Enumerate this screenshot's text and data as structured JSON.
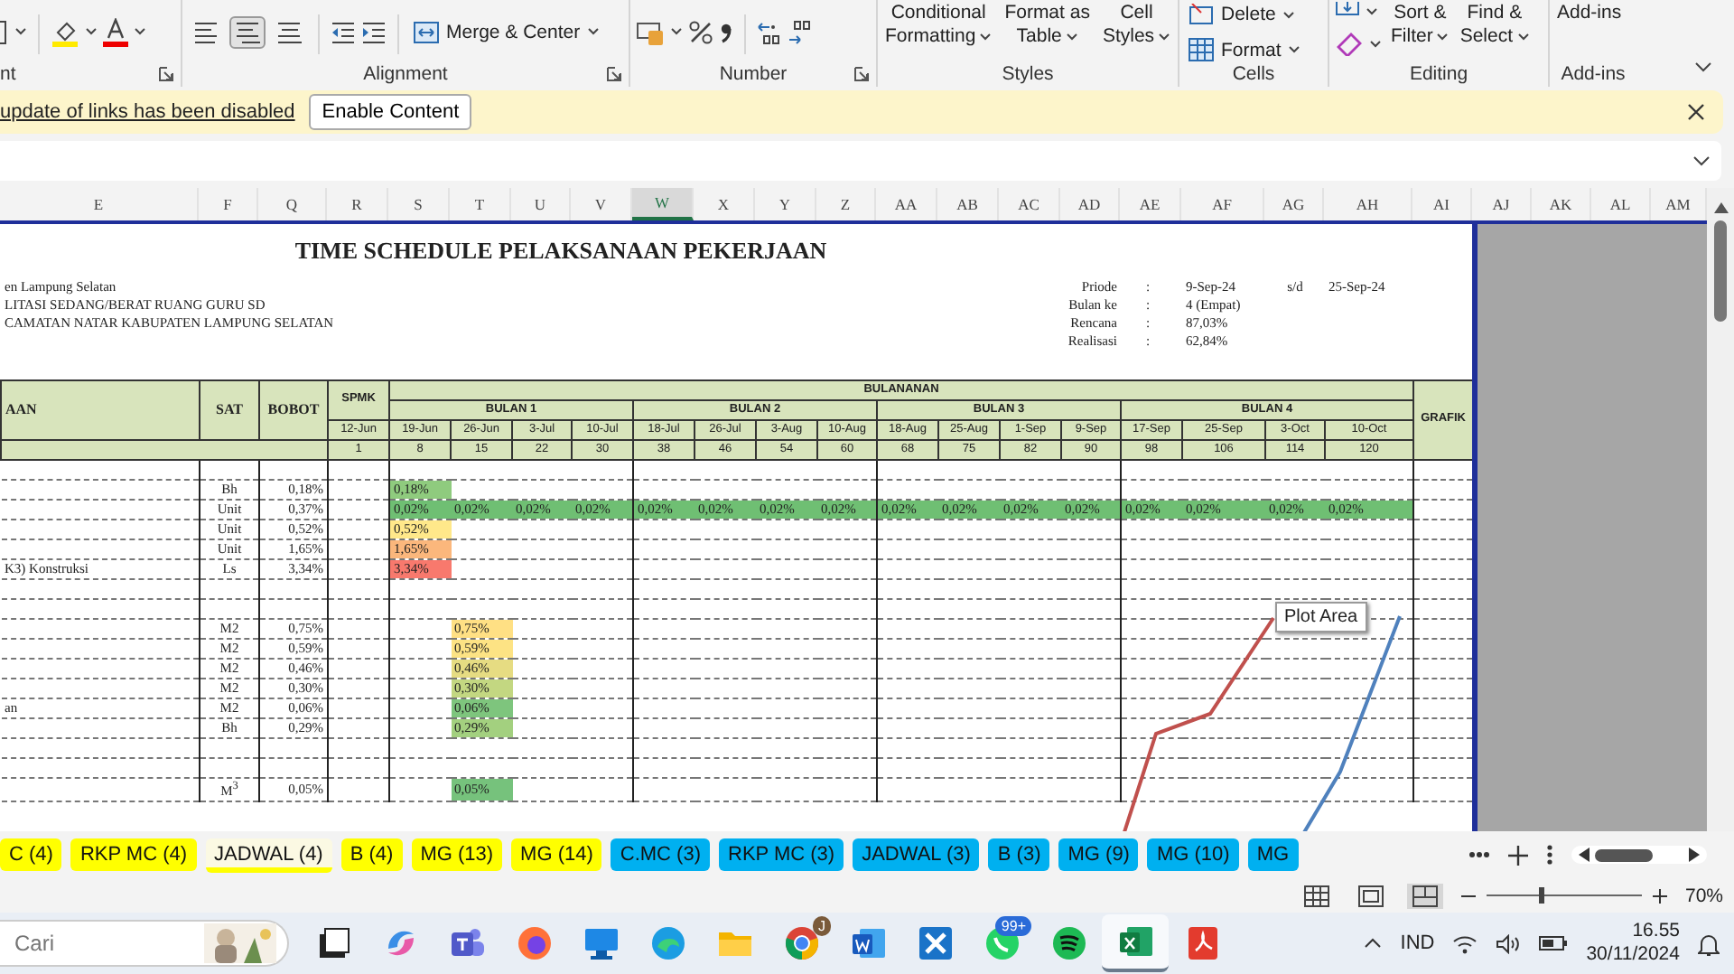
{
  "ribbon": {
    "groups": [
      {
        "kind": "font",
        "label": "nt"
      },
      {
        "kind": "alignment",
        "label": "Alignment",
        "align": [
          {
            "selected": false
          },
          {
            "selected": true
          },
          {
            "selected": false
          }
        ],
        "merge": "Merge & Center"
      },
      {
        "kind": "number",
        "label": "Number"
      },
      {
        "kind": "styles",
        "label": "Styles",
        "buttons": [
          {
            "lines": [
              "Conditional",
              "Formatting"
            ]
          },
          {
            "lines": [
              "Format as",
              "Table"
            ]
          },
          {
            "lines": [
              "Cell",
              "Styles"
            ]
          }
        ]
      },
      {
        "kind": "cells",
        "label": "Cells",
        "buttons": [
          {
            "lines": [
              "Delete"
            ]
          },
          {
            "lines": [
              "Format"
            ]
          }
        ]
      },
      {
        "kind": "editing",
        "label": "Editing",
        "buttons": [
          {
            "lines": [
              "Sort &",
              "Filter"
            ]
          },
          {
            "lines": [
              "Find &",
              "Select"
            ]
          }
        ]
      },
      {
        "kind": "addins",
        "label": "Add-ins",
        "buttons": [
          {
            "lines": [
              "Add-ins"
            ]
          }
        ]
      }
    ]
  },
  "message_bar": {
    "text": "update of links has been disabled",
    "button": "Enable Content"
  },
  "columns": [
    {
      "label": "E",
      "selected": false
    },
    {
      "label": "F",
      "selected": false
    },
    {
      "label": "Q",
      "selected": false
    },
    {
      "label": "R",
      "selected": false
    },
    {
      "label": "S",
      "selected": false
    },
    {
      "label": "T",
      "selected": false
    },
    {
      "label": "U",
      "selected": false
    },
    {
      "label": "V",
      "selected": false
    },
    {
      "label": "W",
      "selected": true
    },
    {
      "label": "X",
      "selected": false
    },
    {
      "label": "Y",
      "selected": false
    },
    {
      "label": "Z",
      "selected": false
    },
    {
      "label": "AA",
      "selected": false
    },
    {
      "label": "AB",
      "selected": false
    },
    {
      "label": "AC",
      "selected": false
    },
    {
      "label": "AD",
      "selected": false
    },
    {
      "label": "AE",
      "selected": false
    },
    {
      "label": "AF",
      "selected": false
    },
    {
      "label": "AG",
      "selected": false
    },
    {
      "label": "AH",
      "selected": false
    },
    {
      "label": "AI",
      "selected": false
    },
    {
      "label": "AJ",
      "selected": false
    },
    {
      "label": "AK",
      "selected": false
    },
    {
      "label": "AL",
      "selected": false
    },
    {
      "label": "AM",
      "selected": false
    }
  ],
  "schedule": {
    "title": "TIME SCHEDULE PELAKSANAAN PEKERJAAN",
    "project_lines": [
      "en Lampung Selatan",
      "LITASI SEDANG/BERAT RUANG GURU SD",
      "CAMATAN NATAR KABUPATEN LAMPUNG SELATAN"
    ],
    "period": [
      {
        "label": "Priode",
        "sep": ":",
        "value": "9-Sep-24",
        "extra_label": "s/d",
        "extra_value": "25-Sep-24"
      },
      {
        "label": "Bulan ke",
        "sep": ":",
        "value": "4 (Empat)"
      },
      {
        "label": "Rencana",
        "sep": ":",
        "value": "87,03%"
      },
      {
        "label": "Realisasi",
        "sep": ":",
        "value": "62,84%"
      }
    ],
    "header": {
      "item": "AAN",
      "unit": "SAT",
      "weight": "BOBOT",
      "spmk": "SPMK",
      "spmk_date": "12-Jun",
      "spmk_week": "1",
      "span": "BULANANAN",
      "graph": "GRAFIK",
      "months": [
        {
          "label": "BULAN 1",
          "weeks": [
            {
              "date": "19-Jun",
              "day": "8"
            },
            {
              "date": "26-Jun",
              "day": "15"
            },
            {
              "date": "3-Jul",
              "day": "22"
            },
            {
              "date": "10-Jul",
              "day": "30"
            }
          ]
        },
        {
          "label": "BULAN 2",
          "weeks": [
            {
              "date": "18-Jul",
              "day": "38"
            },
            {
              "date": "26-Jul",
              "day": "46"
            },
            {
              "date": "3-Aug",
              "day": "54"
            },
            {
              "date": "10-Aug",
              "day": "60"
            }
          ]
        },
        {
          "label": "BULAN 3",
          "weeks": [
            {
              "date": "18-Aug",
              "day": "68"
            },
            {
              "date": "25-Aug",
              "day": "75"
            },
            {
              "date": "1-Sep",
              "day": "82"
            },
            {
              "date": "9-Sep",
              "day": "90"
            }
          ]
        },
        {
          "label": "BULAN 4",
          "weeks": [
            {
              "date": "17-Sep",
              "day": "98"
            },
            {
              "date": "25-Sep",
              "day": "106"
            },
            {
              "date": "3-Oct",
              "day": "114"
            },
            {
              "date": "10-Oct",
              "day": "120"
            }
          ]
        }
      ]
    },
    "rows": [
      {
        "kind": "early",
        "unit": "Bh",
        "weight": "0,18%",
        "weeks": [
          {
            "value": "0,18%",
            "color": "#8fcb7e"
          }
        ]
      },
      {
        "kind": "early",
        "unit": "Unit",
        "weight": "0,37%",
        "weeks": [
          {
            "value": "0,02%",
            "color": "#6fbf73"
          },
          {
            "value": "0,02%",
            "color": "#6fbf73"
          },
          {
            "value": "0,02%",
            "color": "#6fbf73"
          },
          {
            "value": "0,02%",
            "color": "#6fbf73"
          },
          {
            "value": "0,02%",
            "color": "#6fbf73"
          },
          {
            "value": "0,02%",
            "color": "#6fbf73"
          },
          {
            "value": "0,02%",
            "color": "#6fbf73"
          },
          {
            "value": "0,02%",
            "color": "#6fbf73"
          },
          {
            "value": "0,02%",
            "color": "#6fbf73"
          },
          {
            "value": "0,02%",
            "color": "#6fbf73"
          },
          {
            "value": "0,02%",
            "color": "#6fbf73"
          },
          {
            "value": "0,02%",
            "color": "#6fbf73"
          },
          {
            "value": "0,02%",
            "color": "#6fbf73"
          },
          {
            "value": "0,02%",
            "color": "#6fbf73"
          },
          {
            "value": "0,02%",
            "color": "#6fbf73"
          },
          {
            "value": "0,02%",
            "color": "#6fbf73"
          }
        ]
      },
      {
        "kind": "early",
        "unit": "Unit",
        "weight": "0,52%",
        "weeks": [
          {
            "value": "0,52%",
            "color": "#ffe88a"
          }
        ]
      },
      {
        "kind": "early",
        "unit": "Unit",
        "weight": "1,65%",
        "weeks": [
          {
            "value": "1,65%",
            "color": "#fbb77c"
          }
        ]
      },
      {
        "kind": "early",
        "item": "K3) Konstruksi",
        "unit": "Ls",
        "weight": "3,34%",
        "weeks": [
          {
            "value": "3,34%",
            "color": "#f8796d"
          }
        ]
      },
      {
        "kind": "blank"
      },
      {
        "kind": "blank"
      },
      {
        "kind": "late",
        "unit": "M2",
        "weight": "0,75%",
        "weeks": [
          {
            "value": "0,75%",
            "color": "#ffe084"
          }
        ]
      },
      {
        "kind": "late",
        "unit": "M2",
        "weight": "0,59%",
        "weeks": [
          {
            "value": "0,59%",
            "color": "#fde384"
          }
        ]
      },
      {
        "kind": "late",
        "unit": "M2",
        "weight": "0,46%",
        "weeks": [
          {
            "value": "0,46%",
            "color": "#e6dc82"
          }
        ]
      },
      {
        "kind": "late",
        "unit": "M2",
        "weight": "0,30%",
        "weeks": [
          {
            "value": "0,30%",
            "color": "#c3d781"
          }
        ]
      },
      {
        "kind": "late",
        "item": "an",
        "unit": "M2",
        "weight": "0,06%",
        "weeks": [
          {
            "value": "0,06%",
            "color": "#7ec57d"
          }
        ]
      },
      {
        "kind": "late",
        "unit": "Bh",
        "weight": "0,29%",
        "weeks": [
          {
            "value": "0,29%",
            "color": "#a3d07f"
          }
        ]
      },
      {
        "kind": "blank"
      },
      {
        "kind": "blank"
      },
      {
        "kind": "late",
        "unit": "M$^{3}$",
        "weight": "0,05%",
        "weeks": [
          {
            "value": "0,05%",
            "color": "#76c27c"
          }
        ]
      }
    ],
    "chart_tooltip": "Plot Area"
  },
  "sheet_tabs": [
    {
      "label": "C (4)",
      "color": "#ffff00",
      "selected": false
    },
    {
      "label": "RKP MC (4)",
      "color": "#ffff00",
      "selected": false
    },
    {
      "label": "JADWAL (4)",
      "color": "#ffff00",
      "selected": true
    },
    {
      "label": "B (4)",
      "color": "#ffff00",
      "selected": false
    },
    {
      "label": "MG (13)",
      "color": "#ffff00",
      "selected": false
    },
    {
      "label": "MG (14)",
      "color": "#ffff00",
      "selected": false
    },
    {
      "label": "C.MC (3)",
      "color": "#00b0f0",
      "selected": false
    },
    {
      "label": "RKP MC (3)",
      "color": "#00b0f0",
      "selected": false
    },
    {
      "label": "JADWAL (3)",
      "color": "#00b0f0",
      "selected": false
    },
    {
      "label": "B (3)",
      "color": "#00b0f0",
      "selected": false
    },
    {
      "label": "MG (9)",
      "color": "#00b0f0",
      "selected": false
    },
    {
      "label": "MG (10)",
      "color": "#00b0f0",
      "selected": false
    },
    {
      "label": "MG",
      "color": "#00b0f0",
      "selected": false
    }
  ],
  "status_bar": {
    "views": [
      {
        "kind": "normal",
        "selected": false
      },
      {
        "kind": "layout",
        "selected": false
      },
      {
        "kind": "break",
        "selected": true
      }
    ],
    "zoom": {
      "label": "70%",
      "level": 0.34
    }
  },
  "taskbar": {
    "search": {
      "placeholder": "Cari"
    },
    "apps": [
      {
        "kind": "window",
        "selected": false
      },
      {
        "kind": "swirl",
        "selected": false
      },
      {
        "kind": "team",
        "selected": false
      },
      {
        "kind": "fox",
        "selected": false
      },
      {
        "kind": "monitor",
        "selected": false
      },
      {
        "kind": "wave",
        "selected": false
      },
      {
        "kind": "folder",
        "selected": false
      },
      {
        "kind": "browser",
        "badge": "J",
        "selected": false
      },
      {
        "kind": "doc",
        "selected": false
      },
      {
        "kind": "cross",
        "selected": false
      },
      {
        "kind": "chat",
        "badge": "99+",
        "selected": false
      },
      {
        "kind": "music",
        "selected": false
      },
      {
        "kind": "sheet",
        "selected": true
      },
      {
        "kind": "pdf",
        "selected": false
      }
    ],
    "language": "IND",
    "time": "16.55",
    "date": "30/11/2024"
  }
}
